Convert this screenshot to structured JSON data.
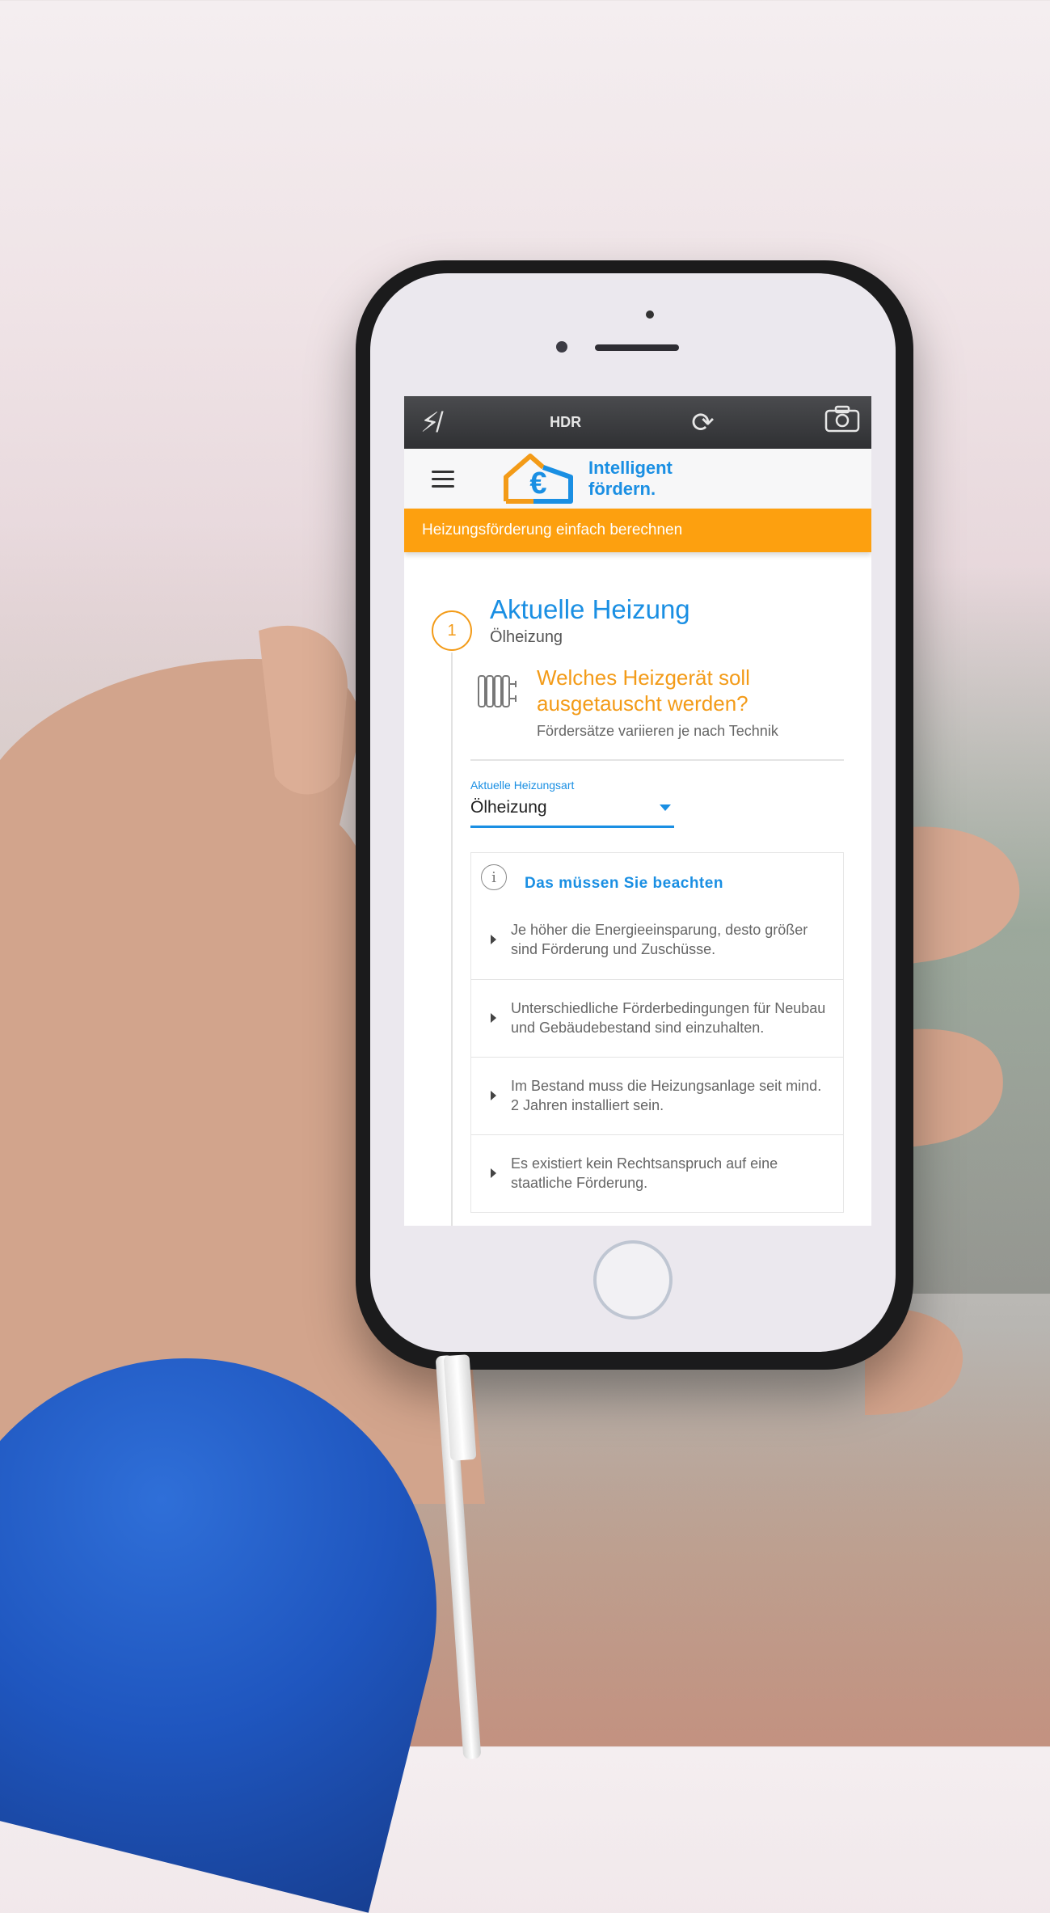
{
  "camera": {
    "flash_label": "⚡̸",
    "hdr_label": "HDR",
    "timer_label": "⟳",
    "switch_label": "⎘"
  },
  "app": {
    "brand_line1": "Intelligent",
    "brand_line2": "fördern.",
    "banner": "Heizungsförderung einfach berechnen"
  },
  "step": {
    "number": "1",
    "title": "Aktuelle Heizung",
    "subtitle": "Ölheizung",
    "question_title": "Welches Heizgerät soll ausgetauscht werden?",
    "question_sub": "Fördersätze variieren je nach Technik"
  },
  "field": {
    "label": "Aktuelle Heizungsart",
    "value": "Ölheizung"
  },
  "info": {
    "title": "Das müssen Sie beachten",
    "items": [
      "Je höher die Energieeinsparung, desto größer sind Förderung und Zuschüsse.",
      "Unterschiedliche Förderbedingungen für Neubau und Gebäudebestand sind einzuhalten.",
      "Im Bestand muss die Heizungsanlage seit mind. 2 Jahren installiert sein.",
      "Es existiert kein Rechtsanspruch auf eine staatliche Förderung."
    ]
  },
  "colors": {
    "brand_blue": "#1a8fe3",
    "accent_orange": "#f39b18",
    "banner_orange": "#fda00f"
  }
}
